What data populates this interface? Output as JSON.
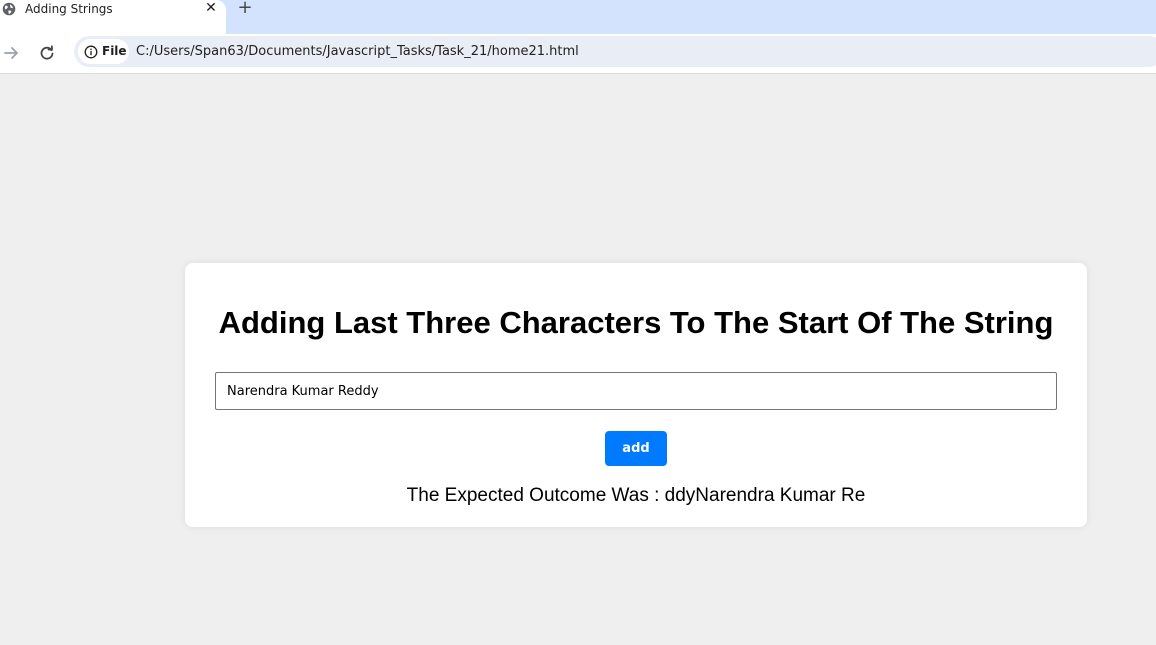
{
  "browser": {
    "tab": {
      "title": "Adding Strings",
      "close_glyph": "✕",
      "icon": "globe-icon"
    },
    "new_tab_glyph": "+",
    "toolbar": {
      "back_icon": "arrow-forward-icon",
      "reload_icon": "reload-icon",
      "site_chip": {
        "label": "File",
        "icon": "info-icon"
      },
      "url": "C:/Users/Span63/Documents/Javascript_Tasks/Task_21/home21.html"
    }
  },
  "page": {
    "heading": "Adding Last Three Characters To The Start Of The String",
    "input": {
      "value": "Narendra Kumar Reddy",
      "placeholder": ""
    },
    "add_button": "add",
    "result_label": "The Expected Outcome Was :",
    "result_value": "ddyNarendra Kumar Re",
    "colors": {
      "button": "#007bff",
      "page_bg": "#efefef",
      "card_bg": "#ffffff"
    }
  }
}
